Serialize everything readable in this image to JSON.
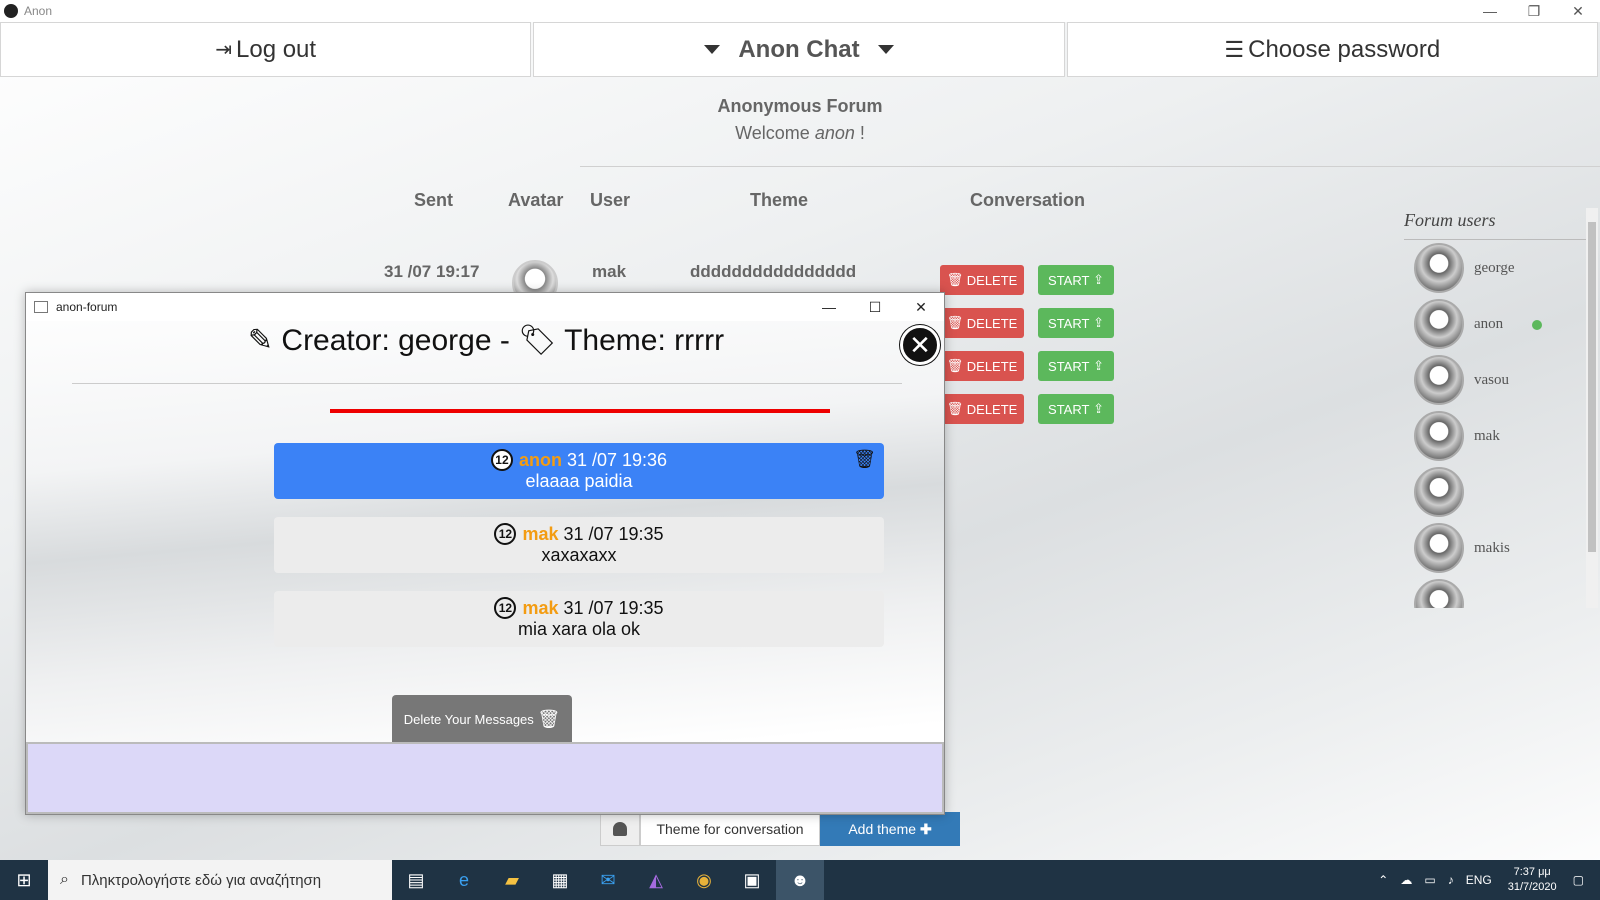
{
  "window": {
    "title": "Anon",
    "controls": [
      "—",
      "❐",
      "✕"
    ]
  },
  "nav": {
    "logout": "Log out",
    "brand": "Anon Chat",
    "choose_password": "Choose password"
  },
  "forum": {
    "title": "Anonymous Forum",
    "welcome_prefix": "Welcome ",
    "welcome_user": "anon",
    "welcome_suffix": " !"
  },
  "table": {
    "headers": {
      "sent": "Sent",
      "avatar": "Avatar",
      "user": "User",
      "theme": "Theme",
      "conversation": "Conversation"
    },
    "row1": {
      "sent": "31 /07 19:17",
      "user": "mak",
      "theme": "dddddddddddddddd"
    },
    "delete_label": "DELETE",
    "start_label": "START"
  },
  "users_panel": {
    "title": "Forum users",
    "users": [
      {
        "name": "george",
        "online": false
      },
      {
        "name": "anon",
        "online": true
      },
      {
        "name": "vasou",
        "online": false
      },
      {
        "name": "mak",
        "online": false
      },
      {
        "name": "",
        "online": false
      },
      {
        "name": "makis",
        "online": false
      }
    ]
  },
  "add_theme": {
    "placeholder": "Theme for conversation",
    "button": "Add theme"
  },
  "popup": {
    "title": "anon-forum",
    "creator_label": "Creator: george - ",
    "theme_label": "Theme: rrrrr",
    "messages": [
      {
        "num": "12",
        "author": "anon",
        "time": "31 /07 19:36",
        "text": "elaaaa paidia",
        "mine": true
      },
      {
        "num": "12",
        "author": "mak",
        "time": "31 /07 19:35",
        "text": "xaxaxaxx",
        "mine": false
      },
      {
        "num": "12",
        "author": "mak",
        "time": "31 /07 19:35",
        "text": "mia xara ola ok",
        "mine": false
      }
    ],
    "delete_messages": "Delete Your Messages"
  },
  "taskbar": {
    "search_placeholder": "Πληκτρολογήστε εδώ για αναζήτηση",
    "lang": "ENG",
    "time": "7:37 μμ",
    "date": "31/7/2020"
  }
}
